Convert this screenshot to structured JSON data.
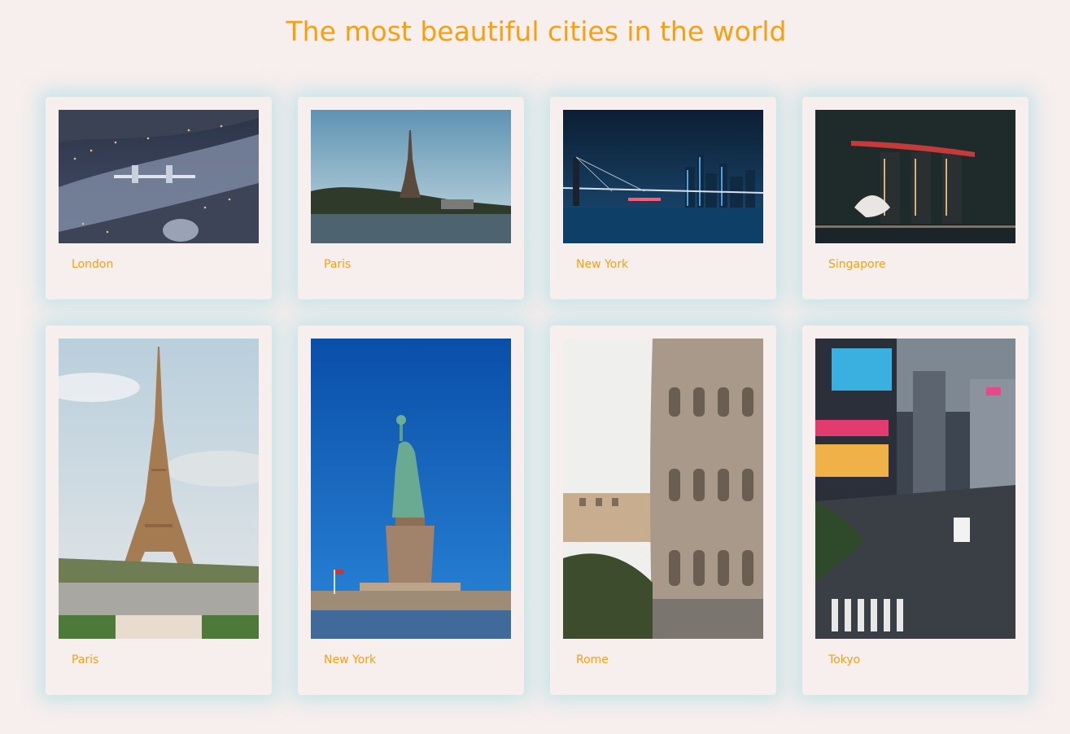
{
  "page": {
    "title": "The most beautiful cities in the world"
  },
  "colors": {
    "accent": "#f5a10f",
    "background": "#f7eeee",
    "card_glow": "#a0dce1"
  },
  "cards": [
    {
      "city": "London"
    },
    {
      "city": "Paris"
    },
    {
      "city": "New York"
    },
    {
      "city": "Singapore"
    },
    {
      "city": "Paris"
    },
    {
      "city": "New York"
    },
    {
      "city": "Rome"
    },
    {
      "city": "Tokyo"
    }
  ]
}
